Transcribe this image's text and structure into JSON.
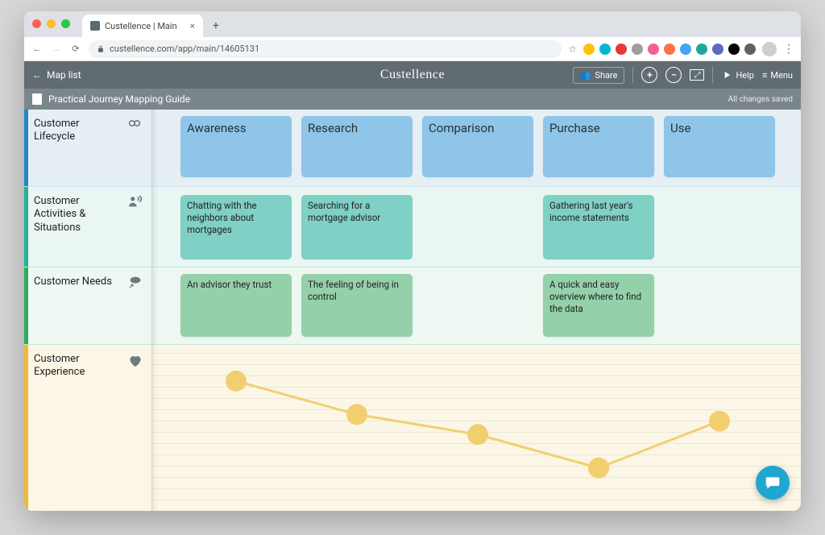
{
  "browser": {
    "tab_title": "Custellence | Main",
    "url": "custellence.com/app/main/14605131",
    "ext_colors": [
      "#ffc107",
      "#00b8d4",
      "#e53935",
      "#9e9e9e",
      "#f06292",
      "#ff7043",
      "#42a5f5",
      "#26a69a",
      "#5c6bc0",
      "#000000",
      "#616161"
    ]
  },
  "app": {
    "map_list": "Map list",
    "brand": "Custellence",
    "share": "Share",
    "help": "Help",
    "menu": "Menu",
    "title": "Practical Journey Mapping Guide",
    "saved": "All changes saved"
  },
  "lanes": {
    "lifecycle": {
      "label": "Customer Lifecycle"
    },
    "activities": {
      "label": "Customer Activities & Situations"
    },
    "needs": {
      "label": "Customer Needs"
    },
    "experience": {
      "label": "Customer Experience"
    }
  },
  "stages": [
    {
      "label": "Awareness"
    },
    {
      "label": "Research"
    },
    {
      "label": "Comparison"
    },
    {
      "label": "Purchase"
    },
    {
      "label": "Use"
    }
  ],
  "activities": {
    "0": "Chatting with the neighbors about mortgages",
    "1": "Searching for a mortgage advisor",
    "3": "Gathering last year's income statements"
  },
  "needs": {
    "0": "An advisor they trust",
    "1": "The feeling of being in control",
    "3": "A quick and easy overview where to find the data"
  },
  "chart_data": {
    "type": "line",
    "title": "Customer Experience",
    "x": [
      0,
      1,
      2,
      3,
      4
    ],
    "y": [
      85,
      60,
      45,
      20,
      55
    ],
    "ylim": [
      0,
      100
    ],
    "stage_labels": [
      "Awareness",
      "Research",
      "Comparison",
      "Purchase",
      "Use"
    ],
    "note": "y is relative sentiment (higher = better); estimated from dot vertical positions"
  }
}
